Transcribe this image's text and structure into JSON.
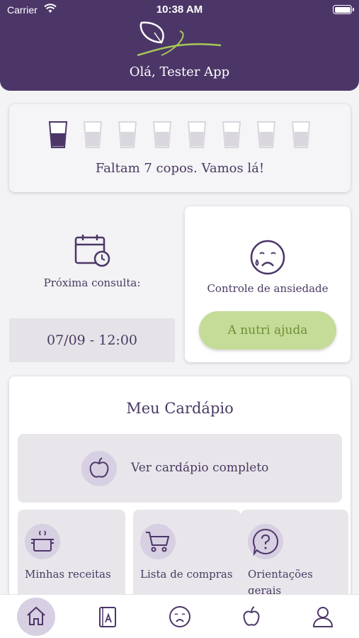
{
  "status_bar": {
    "carrier": "Carrier",
    "time": "10:38 AM"
  },
  "header": {
    "greeting": "Olá, Tester App",
    "logo_icon": "leaf-logo"
  },
  "water": {
    "cups_total": 8,
    "cups_filled": 1,
    "message": "Faltam 7 copos. Vamos lá!"
  },
  "consult": {
    "label": "Próxima consulta:",
    "date": "07/09 - 12:00",
    "icon": "calendar-clock-icon"
  },
  "anxiety": {
    "label": "Controle de ansiedade",
    "button": "A nutri ajuda",
    "icon": "sad-face-icon"
  },
  "menu": {
    "title": "Meu Cardápio",
    "full_menu": "Ver cardápio completo",
    "tiles": [
      {
        "label": "Minhas receitas",
        "icon": "cooking-pot-icon"
      },
      {
        "label": "Lista de compras",
        "icon": "shopping-cart-icon"
      },
      {
        "label": "Orientações gerais",
        "icon": "question-bubble-icon"
      }
    ]
  },
  "tabbar": {
    "items": [
      {
        "icon": "home-icon",
        "active": true
      },
      {
        "icon": "recipe-book-icon",
        "active": false
      },
      {
        "icon": "sad-face-icon",
        "active": false
      },
      {
        "icon": "apple-icon",
        "active": false
      },
      {
        "icon": "user-icon",
        "active": false
      }
    ]
  },
  "colors": {
    "primary": "#4c3668",
    "accent_green": "#c5dc99",
    "icon_bg": "#d7cfe2"
  }
}
